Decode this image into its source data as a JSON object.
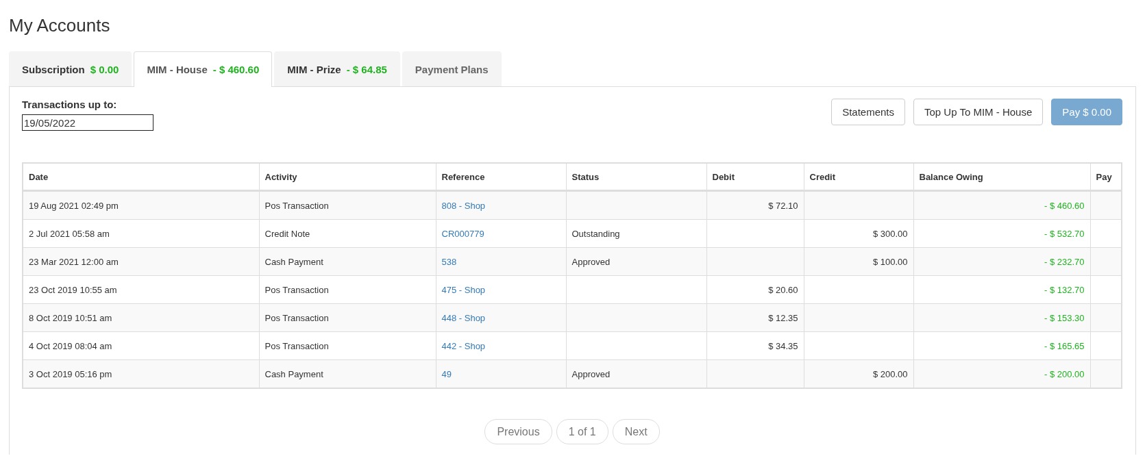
{
  "title": "My Accounts",
  "tabs": [
    {
      "label": "Subscription",
      "amount": "$ 0.00",
      "selected": false
    },
    {
      "label": "MIM - House",
      "amount": "- $ 460.60",
      "selected": true
    },
    {
      "label": "MIM - Prize",
      "amount": "- $ 64.85",
      "selected": false
    },
    {
      "label": "Payment Plans",
      "selected": false
    }
  ],
  "filter": {
    "label": "Transactions up to:",
    "value": "19/05/2022"
  },
  "buttons": [
    {
      "label": "Statements",
      "kind": "default"
    },
    {
      "label": "Top Up To MIM - House",
      "kind": "default"
    },
    {
      "label": "Pay $ 0.00",
      "kind": "primary",
      "disabled": true
    }
  ],
  "table": {
    "columns": [
      "Date",
      "Activity",
      "Reference",
      "Status",
      "Debit",
      "Credit",
      "Balance Owing",
      "Pay"
    ],
    "rows": [
      {
        "date": "19 Aug 2021 02:49 pm",
        "activity": "Pos Transaction",
        "reference": "808 - Shop",
        "debit": "$ 72.10",
        "balance": "- $ 460.60"
      },
      {
        "date": "2 Jul 2021 05:58 am",
        "activity": "Credit Note",
        "reference": "CR000779",
        "status": "Outstanding",
        "credit": "$ 300.00",
        "balance": "- $ 532.70"
      },
      {
        "date": "23 Mar 2021 12:00 am",
        "activity": "Cash Payment",
        "reference": "538",
        "status": "Approved",
        "credit": "$ 100.00",
        "balance": "- $ 232.70"
      },
      {
        "date": "23 Oct 2019 10:55 am",
        "activity": "Pos Transaction",
        "reference": "475 - Shop",
        "debit": "$ 20.60",
        "balance": "- $ 132.70"
      },
      {
        "date": "8 Oct 2019 10:51 am",
        "activity": "Pos Transaction",
        "reference": "448 - Shop",
        "debit": "$ 12.35",
        "balance": "- $ 153.30"
      },
      {
        "date": "4 Oct 2019 08:04 am",
        "activity": "Pos Transaction",
        "reference": "442 - Shop",
        "debit": "$ 34.35",
        "balance": "- $ 165.65"
      },
      {
        "date": "3 Oct 2019 05:16 pm",
        "activity": "Cash Payment",
        "reference": "49",
        "status": "Approved",
        "credit": "$ 200.00",
        "balance": "- $ 200.00"
      }
    ]
  },
  "pagination": {
    "previous": "Previous",
    "page": "1 of 1",
    "next": "Next"
  }
}
